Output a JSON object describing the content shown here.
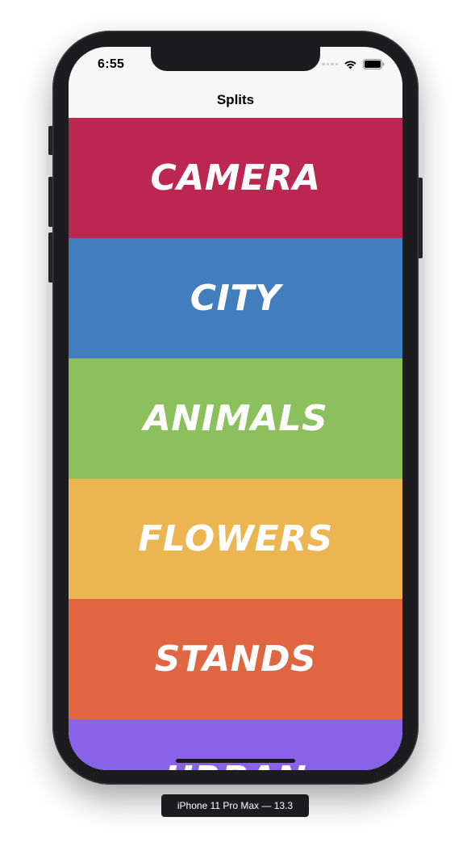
{
  "status_bar": {
    "time": "6:55"
  },
  "nav": {
    "title": "Splits"
  },
  "rows": [
    {
      "label": "CAMERA",
      "color": "#bc2752"
    },
    {
      "label": "CITY",
      "color": "#427ebd"
    },
    {
      "label": "ANIMALS",
      "color": "#8bc05c"
    },
    {
      "label": "FLOWERS",
      "color": "#ebb551"
    },
    {
      "label": "STANDS",
      "color": "#df6641"
    },
    {
      "label": "URBAN",
      "color": "#8862e9"
    }
  ],
  "simulator": {
    "device_label": "iPhone 11 Pro Max — 13.3"
  },
  "icons": {
    "wifi": "wifi-icon",
    "battery": "battery-icon",
    "signal": "cellular-signal-icon"
  }
}
